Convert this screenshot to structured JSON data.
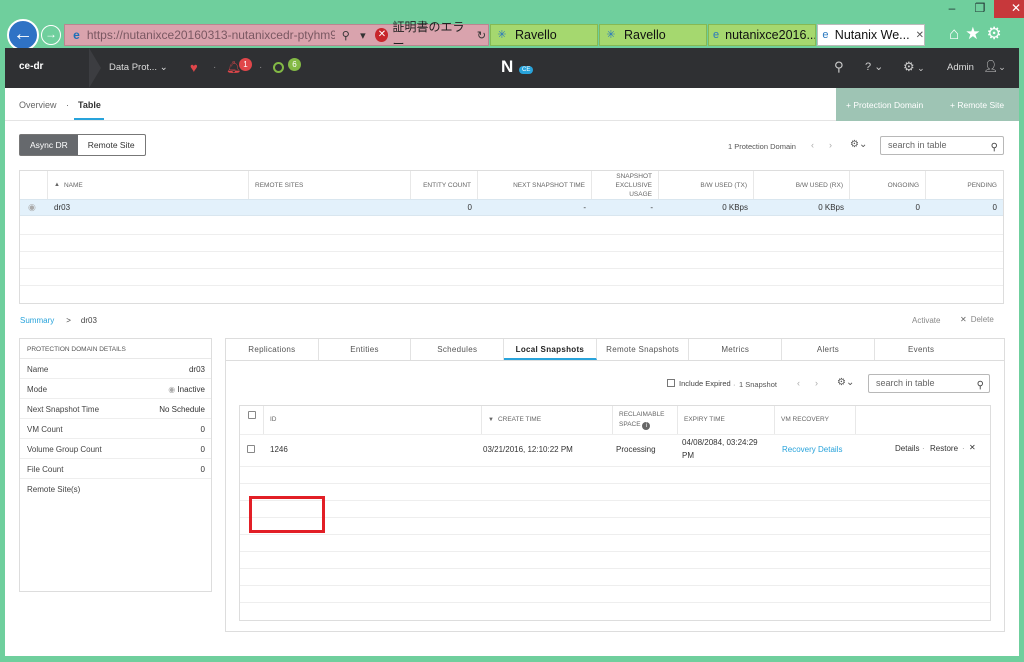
{
  "browser": {
    "address": "https://nutanixce20160313-nutanixcedr-ptyhm9zi...",
    "cert_error": "証明書のエラー",
    "tabs": [
      "Ravello",
      "Ravello",
      "nutanixce2016...",
      "Nutanix We..."
    ],
    "tab_close": "✕",
    "window_buttons": {
      "minimize": "–",
      "restore": "❐",
      "close": "✕"
    }
  },
  "header": {
    "cluster": "ce-dr",
    "section": "Data Prot...",
    "alerts_count": "1",
    "tasks_count": "6",
    "logo": "N",
    "logo_badge": "CE",
    "user": "Admin"
  },
  "subnav": {
    "overview": "Overview",
    "separator": "·",
    "table": "Table",
    "add_pd": "+ Protection Domain",
    "add_rs": "+ Remote Site"
  },
  "pd_section": {
    "seg_async": "Async DR",
    "seg_remote": "Remote Site",
    "count": "1 Protection Domain",
    "search_placeholder": "search in table",
    "columns": [
      "NAME",
      "REMOTE SITES",
      "ENTITY COUNT",
      "NEXT SNAPSHOT TIME",
      "SNAPSHOT EXCLUSIVE USAGE",
      "B/W USED (TX)",
      "B/W USED (RX)",
      "ONGOING",
      "PENDING"
    ],
    "row": {
      "name": "dr03",
      "remote_sites": "",
      "entity_count": "0",
      "next_snapshot": "-",
      "exclusive_usage": "-",
      "bw_tx": "0 KBps",
      "bw_rx": "0 KBps",
      "ongoing": "0",
      "pending": "0"
    }
  },
  "breadcrumb": {
    "summary": "Summary",
    "arrow": ">",
    "current": "dr03"
  },
  "actions": {
    "activate": "Activate",
    "delete": "Delete"
  },
  "details": {
    "title": "PROTECTION DOMAIN DETAILS",
    "rows": [
      {
        "k": "Name",
        "v": "dr03"
      },
      {
        "k": "Mode",
        "v": "Inactive"
      },
      {
        "k": "Next Snapshot Time",
        "v": "No Schedule"
      },
      {
        "k": "VM Count",
        "v": "0"
      },
      {
        "k": "Volume Group Count",
        "v": "0"
      },
      {
        "k": "File Count",
        "v": "0"
      },
      {
        "k": "Remote Site(s)",
        "v": ""
      }
    ]
  },
  "tabs": [
    "Replications",
    "Entities",
    "Schedules",
    "Local Snapshots",
    "Remote Snapshots",
    "Metrics",
    "Alerts",
    "Events"
  ],
  "snapshots": {
    "include_expired": "Include Expired",
    "count": "1 Snapshot",
    "search_placeholder": "search in table",
    "columns": {
      "id": "ID",
      "create_time": "CREATE TIME",
      "reclaimable": "RECLAIMABLE SPACE",
      "expiry": "EXPIRY TIME",
      "vm_recovery": "VM RECOVERY"
    },
    "row": {
      "id": "1246",
      "create_time": "03/21/2016, 12:10:22 PM",
      "reclaimable": "Processing",
      "expiry_line1": "04/08/2084, 03:24:29",
      "expiry_line2": "PM",
      "recovery": "Recovery Details",
      "details": "Details",
      "restore": "Restore"
    }
  },
  "colors": {
    "accent": "#28a3db",
    "header_bg": "#2f3033",
    "highlight": "#e21f26",
    "frame": "#6fcf9d"
  }
}
